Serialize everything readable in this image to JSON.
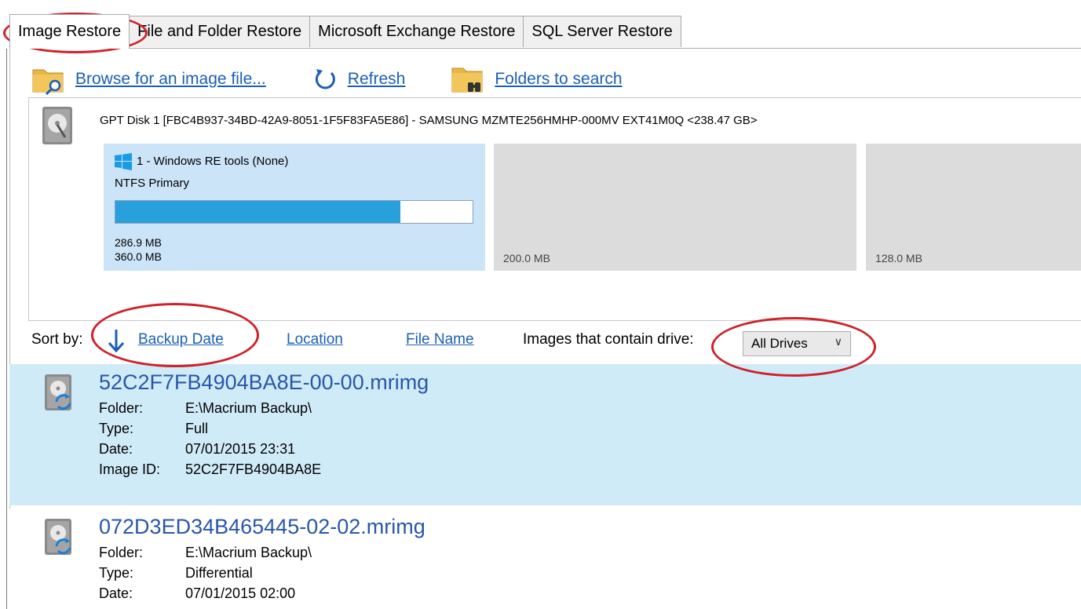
{
  "tabs": [
    {
      "label": "Image Restore",
      "active": true
    },
    {
      "label": "File and Folder Restore",
      "active": false
    },
    {
      "label": "Microsoft Exchange Restore",
      "active": false
    },
    {
      "label": "SQL Server Restore",
      "active": false
    }
  ],
  "toolbar": {
    "browse_label": "Browse for an image file...",
    "refresh_label": "Refresh",
    "folders_label": "Folders to search"
  },
  "disk": {
    "title": "GPT Disk 1 [FBC4B937-34BD-42A9-8051-1F5F83FA5E86] - SAMSUNG MZMTE256HMHP-000MV EXT41M0Q  <238.47 GB>",
    "partitions": [
      {
        "name": "1 - Windows RE tools (None)",
        "fs": "NTFS Primary",
        "used": "286.9 MB",
        "total": "360.0 MB",
        "used_fraction": 0.797
      },
      {
        "size": "200.0 MB"
      },
      {
        "size": "128.0 MB"
      }
    ]
  },
  "sort": {
    "label": "Sort by:",
    "backup_date": "Backup Date",
    "location": "Location",
    "file_name": "File Name",
    "drive_label": "Images that contain drive:",
    "drive_value": "All Drives"
  },
  "images": [
    {
      "file": "52C2F7FB4904BA8E-00-00.mrimg",
      "folder_key": "Folder:",
      "folder": "E:\\Macrium Backup\\",
      "type_key": "Type:",
      "type": "Full",
      "date_key": "Date:",
      "date": "07/01/2015 23:31",
      "id_key": "Image ID:",
      "id": "52C2F7FB4904BA8E"
    },
    {
      "file": "072D3ED34B465445-02-02.mrimg",
      "folder_key": "Folder:",
      "folder": "E:\\Macrium Backup\\",
      "type_key": "Type:",
      "type": "Differential",
      "date_key": "Date:",
      "date": "07/01/2015 02:00"
    }
  ],
  "colors": {
    "accent_link": "#1b5fb5",
    "selected_row": "#d0ebf8",
    "partition_fill": "#27a0dc",
    "annotation": "#d0202a"
  }
}
